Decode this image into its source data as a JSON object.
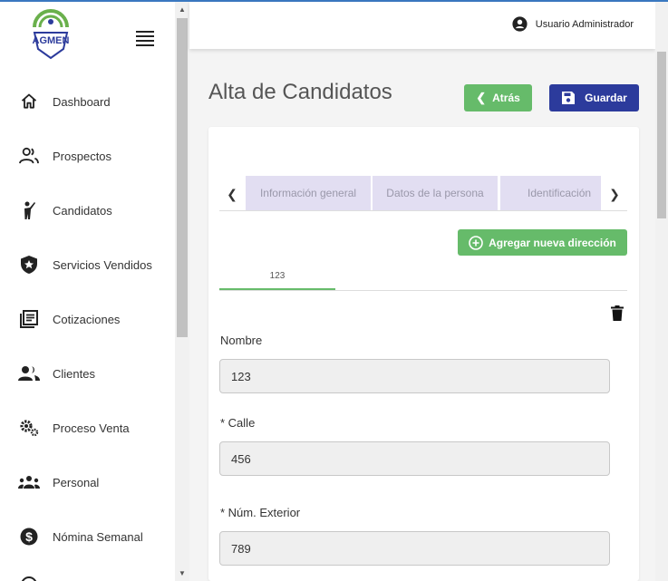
{
  "brand": {
    "logo_text": "AGMEN",
    "colors": {
      "logo_green": "#6ab04c",
      "logo_blue": "#2c3b9c"
    }
  },
  "sidebar": {
    "items": [
      {
        "label": "Dashboard",
        "icon": "home-icon"
      },
      {
        "label": "Prospectos",
        "icon": "people-outline-icon"
      },
      {
        "label": "Candidatos",
        "icon": "person-raise-icon"
      },
      {
        "label": "Servicios Vendidos",
        "icon": "shield-star-icon"
      },
      {
        "label": "Cotizaciones",
        "icon": "document-list-icon"
      },
      {
        "label": "Clientes",
        "icon": "people-icon"
      },
      {
        "label": "Proceso Venta",
        "icon": "gears-icon"
      },
      {
        "label": "Personal",
        "icon": "group-icon"
      },
      {
        "label": "Nómina Semanal",
        "icon": "dollar-circle-icon"
      }
    ]
  },
  "header": {
    "user_name": "Usuario Administrador"
  },
  "page": {
    "title": "Alta de Candidatos",
    "back_label": "Atrás",
    "save_label": "Guardar"
  },
  "tabs": [
    "Información general",
    "Datos de la persona",
    "Identificación"
  ],
  "address": {
    "add_label": "Agregar nueva dirección",
    "tab_label": "123"
  },
  "form": {
    "fields": [
      {
        "label": "Nombre",
        "value": "123"
      },
      {
        "label": "* Calle",
        "value": "456"
      },
      {
        "label": "* Núm. Exterior",
        "value": "789"
      }
    ]
  },
  "colors": {
    "accent_green": "#66bb6a",
    "primary_blue": "#2c3b9c",
    "tab_bg": "#e2def2"
  }
}
